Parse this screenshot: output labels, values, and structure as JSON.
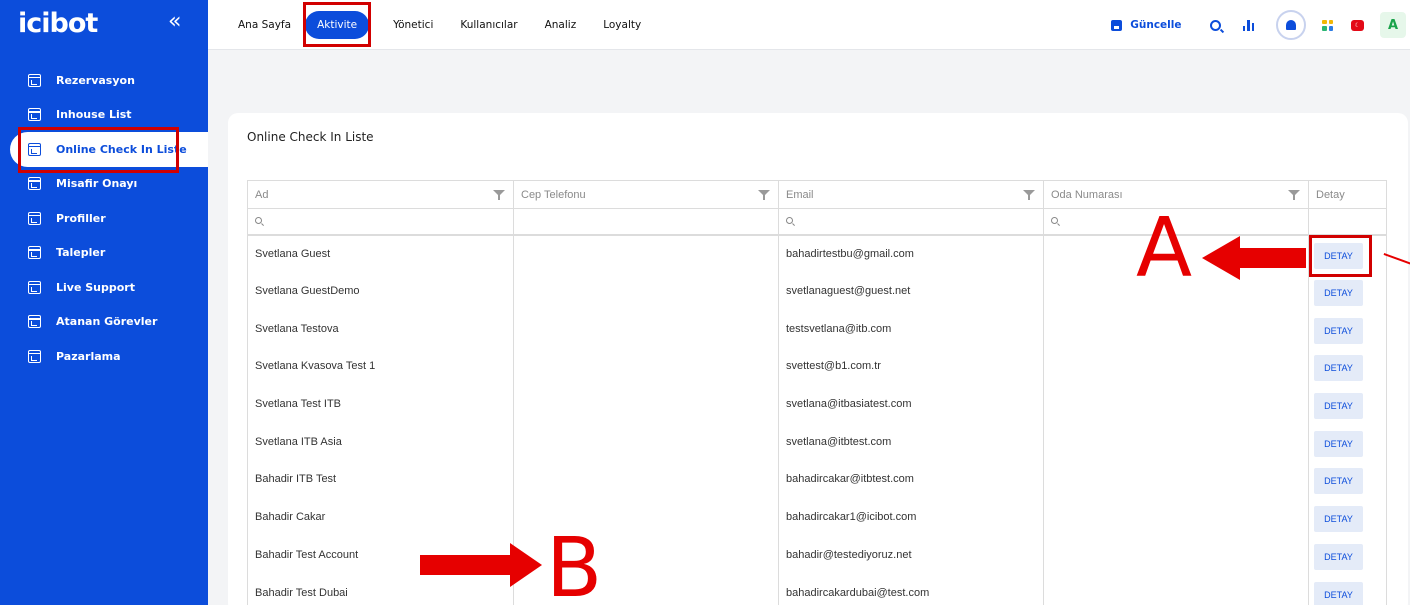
{
  "brand": {
    "logo": "icibot",
    "collapse_icon": "double-chevron-left-icon"
  },
  "sidebar": {
    "items": [
      {
        "label": "Rezervasyon",
        "icon": "calendar-icon"
      },
      {
        "label": "Inhouse List",
        "icon": "calendar-icon"
      },
      {
        "label": "Online Check In Liste",
        "icon": "calendar-icon",
        "active": true
      },
      {
        "label": "Misafir Onayı",
        "icon": "calendar-icon"
      },
      {
        "label": "Profiller",
        "icon": "calendar-icon"
      },
      {
        "label": "Talepler",
        "icon": "calendar-icon"
      },
      {
        "label": "Live Support",
        "icon": "calendar-icon"
      },
      {
        "label": "Atanan Görevler",
        "icon": "calendar-icon"
      },
      {
        "label": "Pazarlama",
        "icon": "calendar-icon"
      }
    ]
  },
  "topnav": {
    "items": [
      "Ana Sayfa",
      "Aktivite",
      "Yönetici",
      "Kullanıcılar",
      "Analiz",
      "Loyalty"
    ],
    "active": "Aktivite"
  },
  "toolbar": {
    "guncelle_label": "Güncelle",
    "avatar_initial": "A",
    "flag_glyph": "☾"
  },
  "card": {
    "title": "Online Check In Liste",
    "columns": [
      "Ad",
      "Cep Telefonu",
      "Email",
      "Oda Numarası",
      "Detay"
    ],
    "rows": [
      {
        "ad": "Svetlana Guest",
        "cep": "",
        "email": "bahadirtestbu@gmail.com",
        "oda": "",
        "detay": "DETAY"
      },
      {
        "ad": "Svetlana GuestDemo",
        "cep": "",
        "email": "svetlanaguest@guest.net",
        "oda": "",
        "detay": "DETAY"
      },
      {
        "ad": "Svetlana Testova",
        "cep": "",
        "email": "testsvetlana@itb.com",
        "oda": "",
        "detay": "DETAY"
      },
      {
        "ad": "Svetlana Kvasova Test 1",
        "cep": "",
        "email": "svettest@b1.com.tr",
        "oda": "",
        "detay": "DETAY"
      },
      {
        "ad": "Svetlana Test ITB",
        "cep": "",
        "email": "svetlana@itbasiatest.com",
        "oda": "",
        "detay": "DETAY"
      },
      {
        "ad": "Svetlana ITB Asia",
        "cep": "",
        "email": "svetlana@itbtest.com",
        "oda": "",
        "detay": "DETAY"
      },
      {
        "ad": "Bahadir ITB Test",
        "cep": "",
        "email": "bahadircakar@itbtest.com",
        "oda": "",
        "detay": "DETAY"
      },
      {
        "ad": "Bahadir Cakar",
        "cep": "",
        "email": "bahadircakar1@icibot.com",
        "oda": "",
        "detay": "DETAY"
      },
      {
        "ad": "Bahadir Test Account",
        "cep": "",
        "email": "bahadir@testediyoruz.net",
        "oda": "",
        "detay": "DETAY"
      },
      {
        "ad": "Bahadir Test Dubai",
        "cep": "",
        "email": "bahadircakardubai@test.com",
        "oda": "",
        "detay": "DETAY"
      }
    ]
  },
  "annotations": {
    "letter_a": "A",
    "letter_b": "B",
    "color": "#e60000"
  },
  "colors": {
    "primary": "#0c4ddb",
    "highlight": "#d10000"
  }
}
